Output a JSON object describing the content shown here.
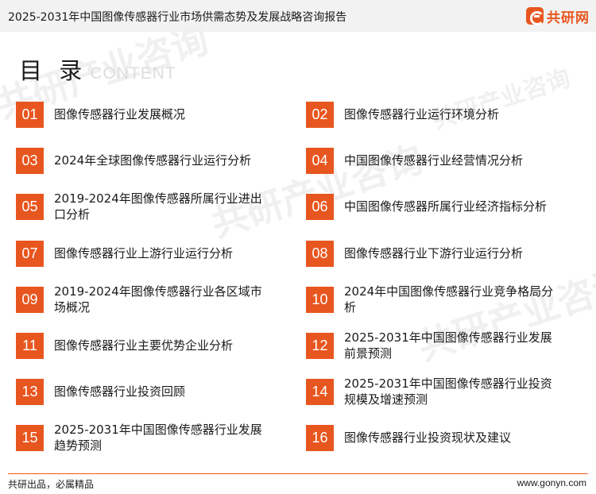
{
  "header": {
    "title": "2025-2031年中国图像传感器行业市场供需态势及发展战略咨询报告",
    "logo_text": "共研网"
  },
  "toc": {
    "title": "目 录",
    "subtitle": "CONTENT",
    "accent_color": "#e8561f",
    "items": [
      {
        "num": "01",
        "label": "图像传感器行业发展概况"
      },
      {
        "num": "02",
        "label": "图像传感器行业运行环境分析"
      },
      {
        "num": "03",
        "label": "2024年全球图像传感器行业运行分析"
      },
      {
        "num": "04",
        "label": "中国图像传感器行业经营情况分析"
      },
      {
        "num": "05",
        "label": "2019-2024年图像传感器所属行业进出口分析"
      },
      {
        "num": "06",
        "label": "中国图像传感器所属行业经济指标分析"
      },
      {
        "num": "07",
        "label": "图像传感器行业上游行业运行分析"
      },
      {
        "num": "08",
        "label": "图像传感器行业下游行业运行分析"
      },
      {
        "num": "09",
        "label": "2019-2024年图像传感器行业各区域市场概况"
      },
      {
        "num": "10",
        "label": "2024年中国图像传感器行业竞争格局分析"
      },
      {
        "num": "11",
        "label": "图像传感器行业主要优势企业分析"
      },
      {
        "num": "12",
        "label": "2025-2031年中国图像传感器行业发展前景预测"
      },
      {
        "num": "13",
        "label": "图像传感器行业投资回顾"
      },
      {
        "num": "14",
        "label": "2025-2031年中国图像传感器行业投资规模及增速预测"
      },
      {
        "num": "15",
        "label": "2025-2031年中国图像传感器行业发展趋势预测"
      },
      {
        "num": "16",
        "label": "图像传感器行业投资现状及建议"
      }
    ]
  },
  "watermark": "共研产业咨询",
  "footer": {
    "left": "共研出品，必属精品",
    "right": "www.gonyn.com"
  }
}
